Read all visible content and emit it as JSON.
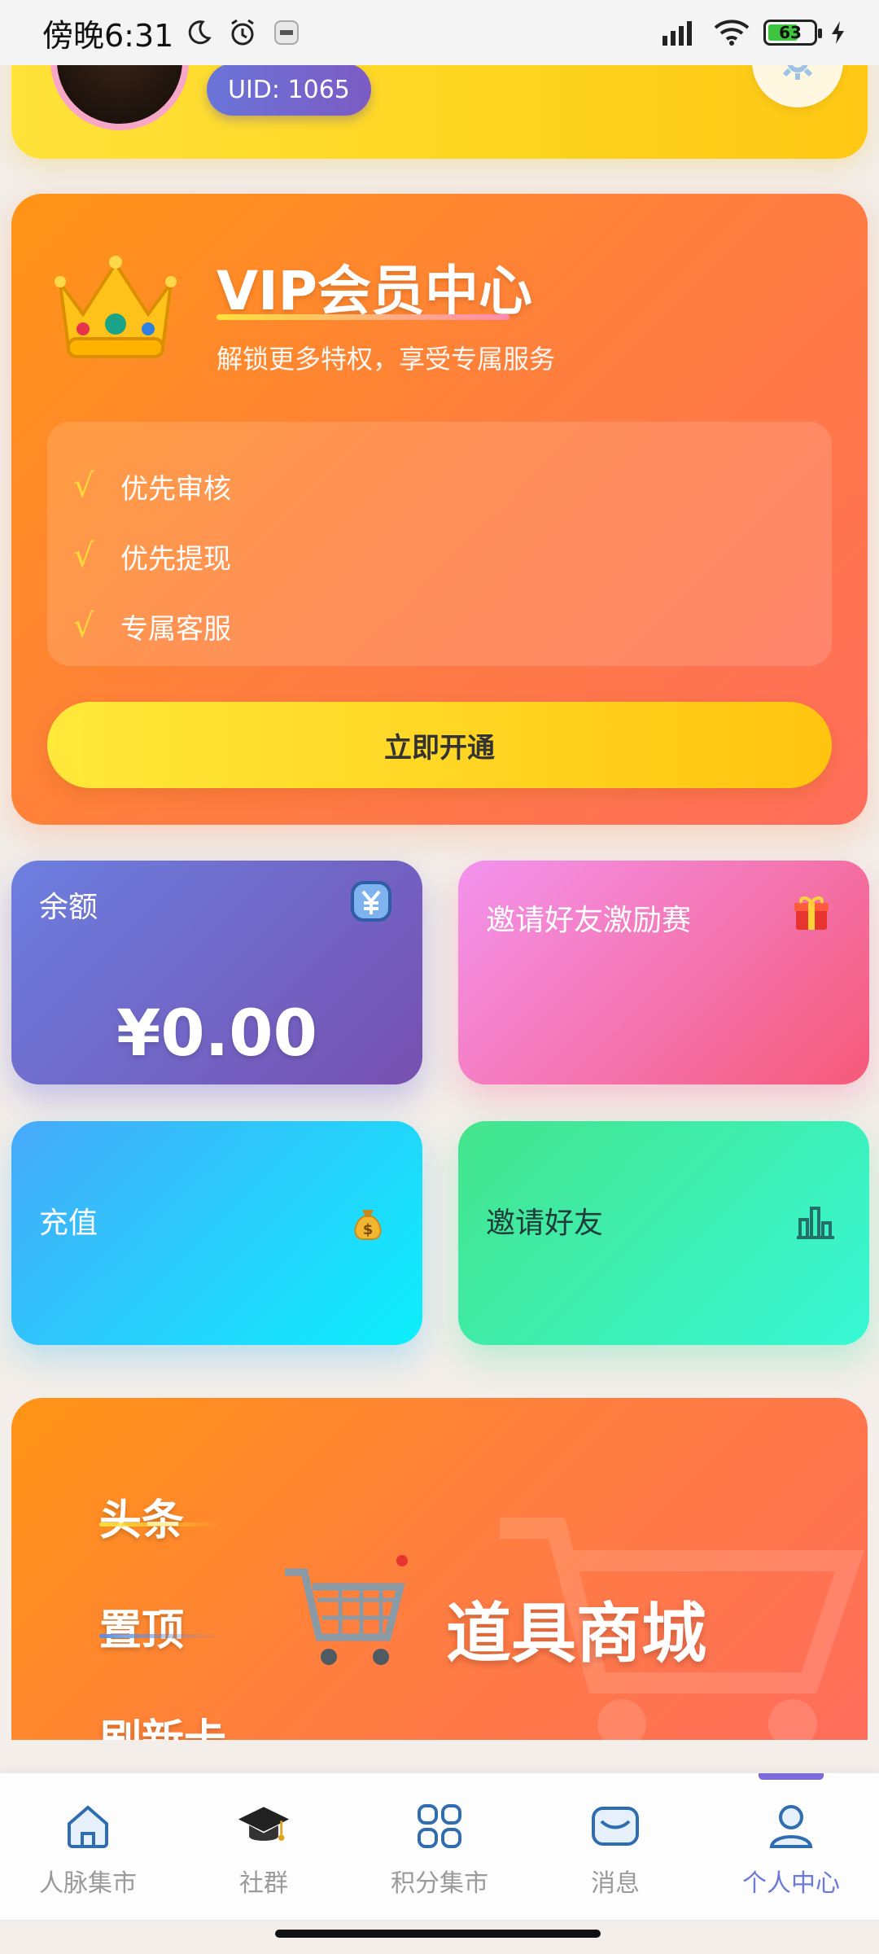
{
  "status_bar": {
    "time": "傍晚6:31",
    "battery": "63"
  },
  "profile": {
    "uid": "UID: 1065"
  },
  "vip": {
    "title": "VIP会员中心",
    "subtitle": "解锁更多特权，享受专属服务",
    "benefits": [
      "优先审核",
      "优先提现",
      "专属客服"
    ],
    "check_mark": "√",
    "open_button": "立即开通"
  },
  "tiles": {
    "balance": {
      "label": "余额",
      "amount": "¥0.00",
      "icon": "yen-icon"
    },
    "contest": {
      "label": "邀请好友激励赛",
      "icon": "gift-icon"
    },
    "recharge": {
      "label": "充值",
      "icon": "money-bag-icon"
    },
    "invite": {
      "label": "邀请好友",
      "icon": "bar-chart-icon"
    }
  },
  "shop": {
    "items": [
      "头条",
      "置顶",
      "刷新卡"
    ],
    "title": "道具商城"
  },
  "tab_bar": {
    "tabs": [
      {
        "label": "人脉集市",
        "icon": "home-icon"
      },
      {
        "label": "社群",
        "icon": "graduation-cap-icon"
      },
      {
        "label": "积分集市",
        "icon": "grid-icon"
      },
      {
        "label": "消息",
        "icon": "message-icon"
      },
      {
        "label": "个人中心",
        "icon": "user-icon",
        "active": true
      }
    ]
  },
  "colors": {
    "accent": "#6a7ad8",
    "vip_orange": "#ff8a2a",
    "gold": "#ffd01e"
  }
}
